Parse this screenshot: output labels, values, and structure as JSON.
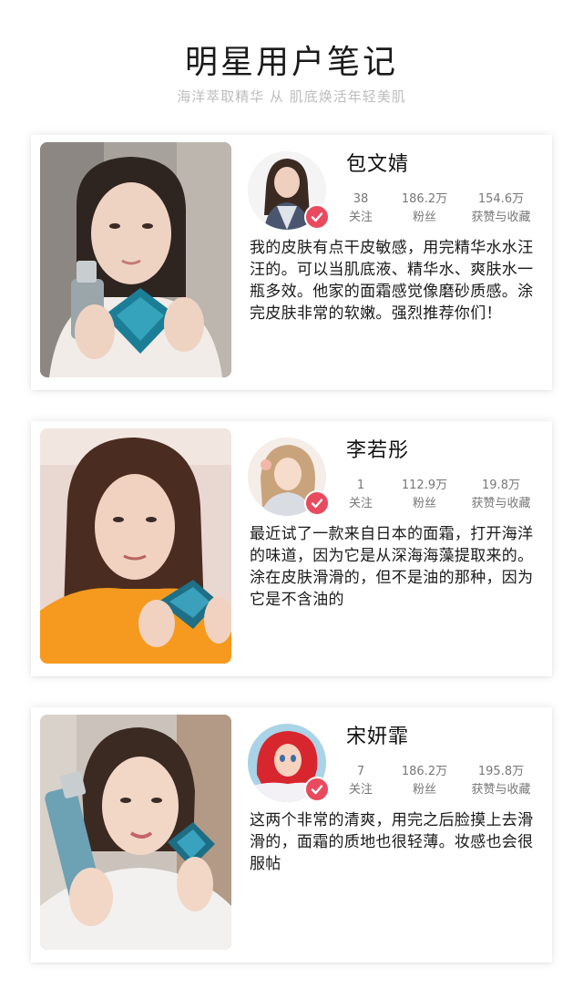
{
  "header": {
    "title": "明星用户笔记",
    "subtitle": "海洋萃取精华 从 肌底焕活年轻美肌"
  },
  "stat_labels": {
    "following": "关注",
    "fans": "粉丝",
    "likes": "获赞与收藏"
  },
  "cards": [
    {
      "name": "包文婧",
      "following": "38",
      "fans": "186.2万",
      "likes": "154.6万",
      "note": "我的皮肤有点干皮敏感，用完精华水水汪汪的。可以当肌底液、精华水、爽肤水一瓶多效。他家的面霜感觉像磨砂质感。涂完皮肤非常的软嫩。强烈推荐你们！"
    },
    {
      "name": "李若彤",
      "following": "1",
      "fans": "112.9万",
      "likes": "19.8万",
      "note": "最近试了一款来自日本的面霜，打开海洋的味道，因为它是从深海海藻提取来的。涂在皮肤滑滑的，但不是油的那种，因为它是不含油的"
    },
    {
      "name": "宋妍霏",
      "following": "7",
      "fans": "186.2万",
      "likes": "195.8万",
      "note": "这两个非常的清爽，用完之后脸摸上去滑滑的，面霜的质地也很轻薄。妆感也会很服帖"
    }
  ],
  "colors": {
    "verified_badge": "#e84a5f",
    "subtitle": "#bdbdbd",
    "stats": "#777777"
  },
  "icons": {
    "verified": "check-badge-icon"
  }
}
